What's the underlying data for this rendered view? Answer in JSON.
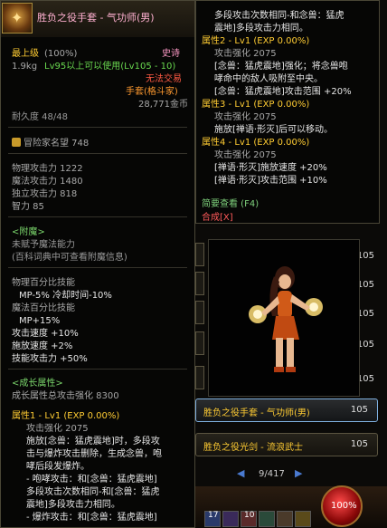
{
  "item": {
    "name": "胜负之役手套 - 气功师(男)",
    "grade": "最上级",
    "grade_pct": "(100%)",
    "rarity": "史诗",
    "weight": "1.9kg",
    "level_req": "Lv95以上可以使用(Lv105 - 10)",
    "trade": "无法交易",
    "slot_label": "手套",
    "slot_type": "(格斗家)",
    "price": "28,771金币",
    "durability": "耐久度 48/48",
    "reputation": "冒险家名望 748",
    "stats": [
      "物理攻击力 1222",
      "魔法攻击力 1480",
      "独立攻击力 818",
      "智力 85"
    ],
    "enchant_header": "<附魔>",
    "enchant_lines": [
      "未赋予魔法能力",
      "(百科词典中可查看附魔信息)"
    ],
    "skill_stats": [
      "物理百分比技能",
      "MP-5% 冷却时间-10%",
      "魔法百分比技能",
      "MP+15%",
      "攻击速度 +10%",
      "施放速度 +2%",
      "技能攻击力 +50%"
    ],
    "growth_header": "<成长属性>",
    "growth_total": "成长属性总攻击强化 8300",
    "attr1_title": "属性1 - Lv1 (EXP 0.00%)",
    "attr1_lines": [
      "攻击强化 2075",
      "施放[念兽：猛虎震地]时，多段攻",
      "击与爆炸攻击删除，生成念兽，咆",
      "哮后段发爆炸。",
      "- 咆哮攻击：和[念兽：猛虎震地]",
      "多段攻击次数相同-和[念兽：猛虎",
      "震地]多段攻击力相同。",
      "- 爆炸攻击：和[念兽：猛虎震地]"
    ]
  },
  "detail": {
    "lines": [
      "多段攻击次数相同-和念兽：猛虎",
      "震地]多段攻击力相同。",
      "属性2 - Lv1 (EXP 0.00%)",
      "攻击强化 2075",
      "[念兽：猛虎震地]强化；将念兽咆",
      "哮命中的敌人吸附至中央。",
      "[念兽：猛虎震地]攻击范围 +20%",
      "属性3 - Lv1 (EXP 0.00%)",
      "攻击强化 2075",
      "施放[禅语·形灭]后可以移动。",
      "属性4 - Lv1 (EXP 0.00%)",
      "攻击强化 2075",
      "[禅语·形灭]施放速度 +20%",
      "[禅语·形灭]攻击范围 +10%"
    ],
    "simple_view": "简要查看 (F4)",
    "synthesize": "合成[X]"
  },
  "list": {
    "side_levels": [
      "105",
      "105",
      "105",
      "105",
      "105"
    ],
    "items": [
      {
        "name": "胜负之役手套 - 气功师(男)",
        "level": "105"
      },
      {
        "name": "胜负之役光剑 - 流浪武士",
        "level": "105"
      }
    ],
    "page": "9/417",
    "prev_arrow": "◀",
    "next_arrow": "▶"
  },
  "hud": {
    "hp": "100%",
    "skill_counts": [
      "17",
      "10"
    ]
  }
}
